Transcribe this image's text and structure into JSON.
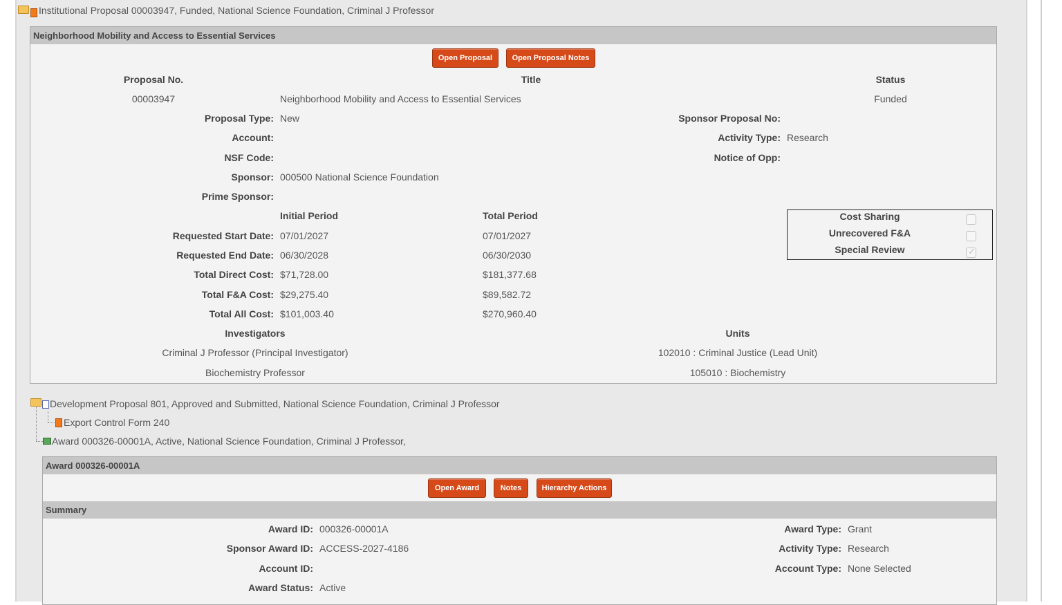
{
  "node1": {
    "text": "Institutional Proposal 00003947, Funded, National Science Foundation, Criminal J Professor"
  },
  "ip_panel": {
    "title": "Neighborhood Mobility and Access to Essential Services",
    "open_proposal": "Open Proposal",
    "open_notes": "Open Proposal Notes",
    "headers": {
      "proposal_no": "Proposal No.",
      "title": "Title",
      "status": "Status"
    },
    "proposal_no": "00003947",
    "status": "Funded",
    "labels": {
      "proposal_type": "Proposal Type:",
      "account": "Account:",
      "nsf_code": "NSF Code:",
      "sponsor": "Sponsor:",
      "prime_sponsor": "Prime Sponsor:",
      "sponsor_proposal_no": "Sponsor Proposal No:",
      "activity_type": "Activity Type:",
      "notice_of_opp": "Notice of Opp:",
      "initial_period": "Initial Period",
      "total_period": "Total Period",
      "req_start": "Requested Start Date:",
      "req_end": "Requested End Date:",
      "direct": "Total Direct Cost:",
      "fa": "Total F&A Cost:",
      "all": "Total All Cost:",
      "investigators": "Investigators",
      "units": "Units"
    },
    "proposal_type": "New",
    "activity_type": "Research",
    "sponsor": "000500 National Science Foundation",
    "initial": {
      "start": "07/01/2027",
      "end": "06/30/2028",
      "direct": "$71,728.00",
      "fa": "$29,275.40",
      "all": "$101,003.40"
    },
    "total": {
      "start": "07/01/2027",
      "end": "06/30/2030",
      "direct": "$181,377.68",
      "fa": "$89,582.72",
      "all": "$270,960.40"
    },
    "flags": {
      "cost_sharing": "Cost Sharing",
      "unrecovered": "Unrecovered F&A",
      "special_review": "Special Review"
    },
    "investigators": [
      "Criminal J Professor (Principal Investigator)",
      "Biochemistry Professor"
    ],
    "units": [
      "102010 : Criminal Justice (Lead Unit)",
      "105010 : Biochemistry"
    ]
  },
  "node2": {
    "text": "Development Proposal 801, Approved and Submitted, National Science Foundation, Criminal J Professor"
  },
  "node3": {
    "text": "Export Control Form 240"
  },
  "node4": {
    "text": "Award 000326-00001A, Active, National Science Foundation, Criminal J Professor,"
  },
  "award_panel": {
    "title": "Award 000326-00001A",
    "open_award": "Open Award",
    "notes": "Notes",
    "hierarchy": "Hierarchy Actions",
    "summary": "Summary",
    "labels": {
      "award_id": "Award ID:",
      "sponsor_award_id": "Sponsor Award ID:",
      "account_id": "Account ID:",
      "award_status": "Award Status:",
      "award_type": "Award Type:",
      "activity_type": "Activity Type:",
      "account_type": "Account Type:"
    },
    "award_id": "000326-00001A",
    "sponsor_award_id": "ACCESS-2027-4186",
    "award_status": "Active",
    "award_type": "Grant",
    "activity_type": "Research",
    "account_type": "None Selected"
  }
}
